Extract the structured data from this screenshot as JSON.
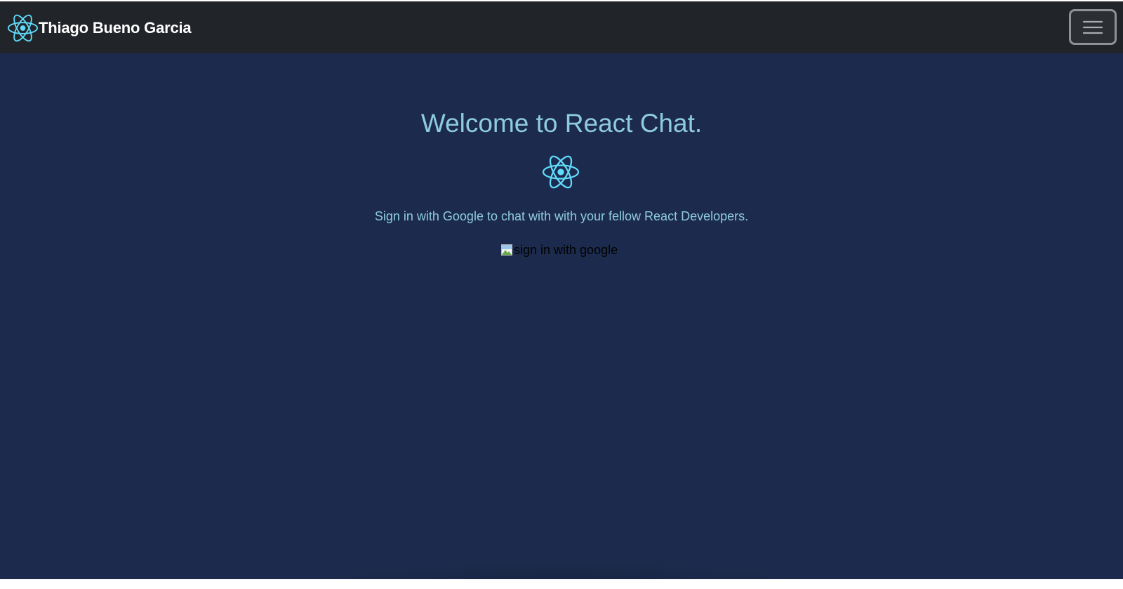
{
  "navbar": {
    "brand_name": "Thiago Bueno Garcia",
    "brand_icon": "react-logo-icon",
    "menu_icon": "hamburger-menu-icon",
    "background_color": "#212529"
  },
  "hero": {
    "title": "Welcome to React Chat.",
    "logo_icon": "react-logo-icon",
    "subtitle": "Sign in with Google to chat with with your fellow React Developers.",
    "signin_image_alt": "sign in with google",
    "background_color": "#1c2b4d",
    "text_color": "#8fcbe0",
    "accent_color": "#61dafb"
  }
}
